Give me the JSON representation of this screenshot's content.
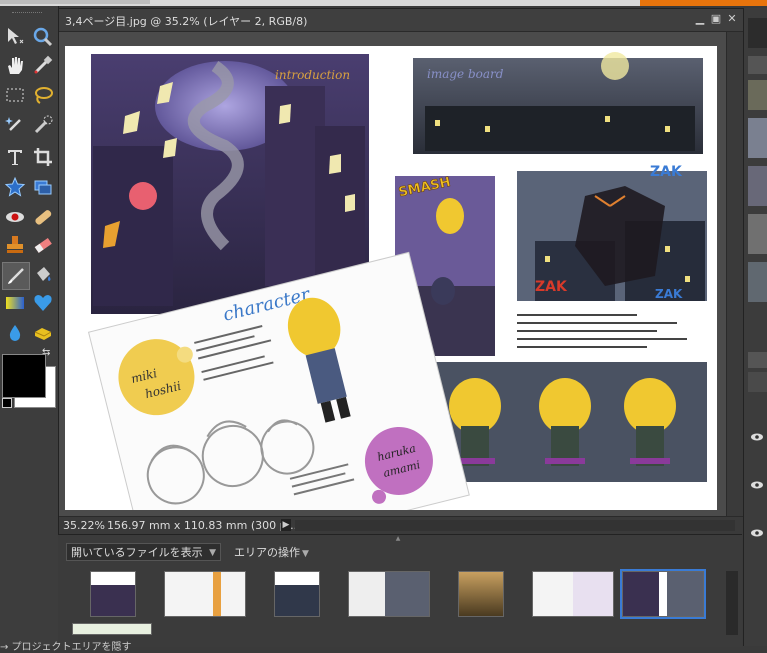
{
  "document": {
    "title": "3,4ページ目.jpg @ 35.2% (レイヤー 2, RGB/8)",
    "zoom": "35.22%",
    "dimensions": "156.97 mm x 110.83 mm (300 p..."
  },
  "window_buttons": {
    "minimize": "▁",
    "restore": "▣",
    "close": "✕"
  },
  "artwork": {
    "intro_label": "introduction",
    "board_label": "image board",
    "character_label": "character",
    "name1_a": "miki",
    "name1_b": "hoshii",
    "name2_a": "haruka",
    "name2_b": "amami",
    "sfx_smash": "SMASH",
    "sfx_zak1": "ZAK",
    "sfx_zak2": "ZAK",
    "sfx_zak3": "ZAK"
  },
  "bin": {
    "show_files": "開いているファイルを表示",
    "area_action": "エリアの操作",
    "bottom_text": "→ プロジェクトエリアを隠す"
  },
  "tools": [
    {
      "name": "move-tool-icon"
    },
    {
      "name": "zoom-tool-icon"
    },
    {
      "name": "hand-tool-icon"
    },
    {
      "name": "eyedropper-tool-icon"
    },
    {
      "name": "marquee-tool-icon"
    },
    {
      "name": "lasso-tool-icon"
    },
    {
      "name": "magic-wand-tool-icon"
    },
    {
      "name": "quick-selection-tool-icon"
    },
    {
      "name": "type-tool-icon"
    },
    {
      "name": "crop-tool-icon"
    },
    {
      "name": "shape-tool-icon"
    },
    {
      "name": "recompose-tool-icon"
    },
    {
      "name": "red-eye-tool-icon"
    },
    {
      "name": "healing-brush-tool-icon"
    },
    {
      "name": "clone-stamp-tool-icon"
    },
    {
      "name": "eraser-tool-icon"
    },
    {
      "name": "brush-tool-icon"
    },
    {
      "name": "paint-bucket-tool-icon"
    },
    {
      "name": "gradient-tool-icon"
    },
    {
      "name": "custom-shape-tool-icon"
    },
    {
      "name": "blur-tool-icon"
    },
    {
      "name": "sponge-tool-icon"
    }
  ],
  "colors": {
    "foreground": "#000000",
    "background": "#ffffff",
    "accent_orange": "#e8740c",
    "selection_blue": "#3a7bd5"
  }
}
